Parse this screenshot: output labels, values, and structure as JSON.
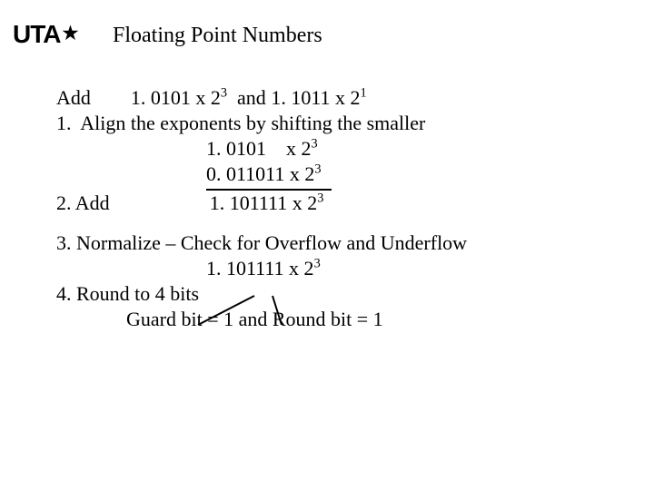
{
  "logo": {
    "text": "UTA",
    "star": "★"
  },
  "title": "Floating Point Numbers",
  "line_add_label": "Add",
  "line_add_a1": "1. 0101 x 2",
  "line_add_a1_exp": "3",
  "line_add_mid": "  and ",
  "line_add_a2": "1. 1011 x 2",
  "line_add_a2_exp": "1",
  "step1": "1.  Align the exponents by shifting the smaller",
  "align_r1_indent": "                              ",
  "align_r1_val": "1. 0101    x 2",
  "align_r1_exp": "3",
  "align_r2_indent": "                              ",
  "align_r2_val": "0. 011011 x 2",
  "align_r2_exp": "3",
  "step2_label": "2. Add",
  "step2_indent": "                    ",
  "step2_val": "1. 101111 x 2",
  "step2_exp": "3",
  "step3": "3. Normalize – Check for Overflow and Underflow",
  "norm_indent": "                              ",
  "norm_val": "1. 101111 x 2",
  "norm_exp": "3",
  "step4": "4. Round to 4 bits",
  "guard_indent": "              ",
  "guard": "Guard bit = 1 and Round bit = 1"
}
